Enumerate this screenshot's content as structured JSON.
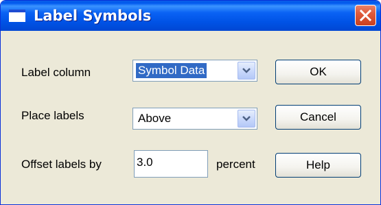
{
  "window": {
    "title": "Label Symbols",
    "title_icon": "window-icon",
    "close_icon": "close-icon"
  },
  "form": {
    "label_column": {
      "label": "Label column",
      "value": "Symbol Data"
    },
    "place_labels": {
      "label": "Place labels",
      "value": "Above"
    },
    "offset": {
      "label": "Offset labels by",
      "value": "3.0",
      "unit": "percent"
    }
  },
  "buttons": {
    "ok": "OK",
    "cancel": "Cancel",
    "help": "Help"
  },
  "colors": {
    "title_bar": "#0058ee",
    "close_button": "#e05a3c",
    "dialog_face": "#ece9d8",
    "selection": "#316ac5"
  }
}
